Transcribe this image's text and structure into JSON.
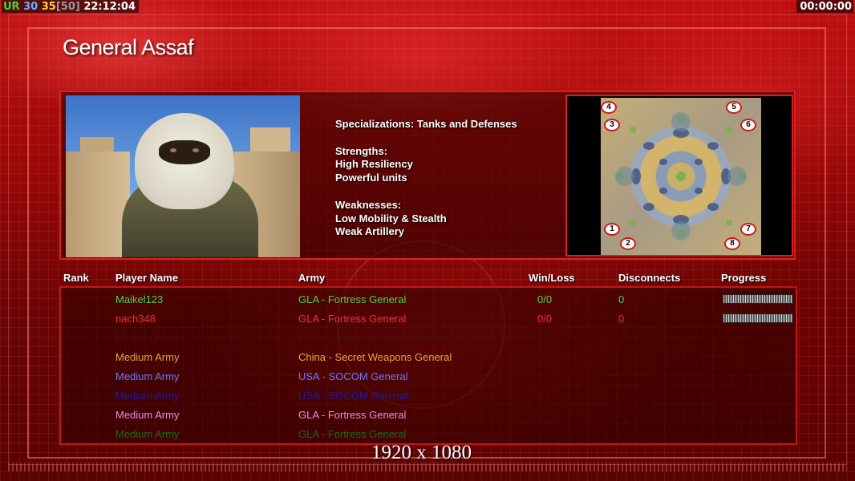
{
  "hud": {
    "ur_label": "UR",
    "fps_current": "30",
    "fps_avg": "35",
    "fps_limit": "[50]",
    "clock": "22:12:04",
    "timer": "00:00:00"
  },
  "general": {
    "title": "General Assaf",
    "specializations": "Specializations: Tanks and Defenses",
    "strengths_label": "Strengths:",
    "strengths": [
      "High Resiliency",
      "Powerful units"
    ],
    "weaknesses_label": "Weaknesses:",
    "weaknesses": [
      "Low Mobility & Stealth",
      "Weak Artillery"
    ]
  },
  "minimap": {
    "spawns": [
      "1",
      "2",
      "3",
      "4",
      "5",
      "6",
      "7",
      "8"
    ]
  },
  "table": {
    "headers": {
      "rank": "Rank",
      "player": "Player Name",
      "army": "Army",
      "winloss": "Win/Loss",
      "disconnects": "Disconnects",
      "progress": "Progress"
    },
    "rows": [
      {
        "rank": "",
        "player": "Maikel123",
        "army": "GLA - Fortress General",
        "winloss": "0/0",
        "disconnects": "0",
        "color": "#4fd04f",
        "progress": true
      },
      {
        "rank": "",
        "player": "nach348",
        "army": "GLA - Fortress General",
        "winloss": "0/0",
        "disconnects": "0",
        "color": "#ff2a2a",
        "progress": true
      },
      {
        "rank": "",
        "player": "Medium Army",
        "army": "China - Secret Weapons General",
        "winloss": "",
        "disconnects": "",
        "color": "#4a0e0e",
        "progress": false
      },
      {
        "rank": "",
        "player": "Medium Army",
        "army": "China - Secret Weapons General",
        "winloss": "",
        "disconnects": "",
        "color": "#f0a040",
        "progress": false
      },
      {
        "rank": "",
        "player": "Medium Army",
        "army": "USA - SOCOM General",
        "winloss": "",
        "disconnects": "",
        "color": "#6a78ff",
        "progress": false
      },
      {
        "rank": "",
        "player": "Medium Army",
        "army": "USA - SOCOM General",
        "winloss": "",
        "disconnects": "",
        "color": "#1a1aa0",
        "progress": false
      },
      {
        "rank": "",
        "player": "Medium Army",
        "army": "GLA - Fortress General",
        "winloss": "",
        "disconnects": "",
        "color": "#e090e8",
        "progress": false
      },
      {
        "rank": "",
        "player": "Medium Army",
        "army": "GLA - Fortress General",
        "winloss": "",
        "disconnects": "",
        "color": "#1a6a1a",
        "progress": false
      }
    ]
  },
  "resolution_label": "1920 x 1080",
  "colors": {
    "hud_green": "#3ddc3d",
    "hud_blue": "#6ab4ff",
    "hud_yellow": "#ffd23a",
    "hud_gray": "#9a9a9a",
    "panel_border": "#d92020"
  }
}
